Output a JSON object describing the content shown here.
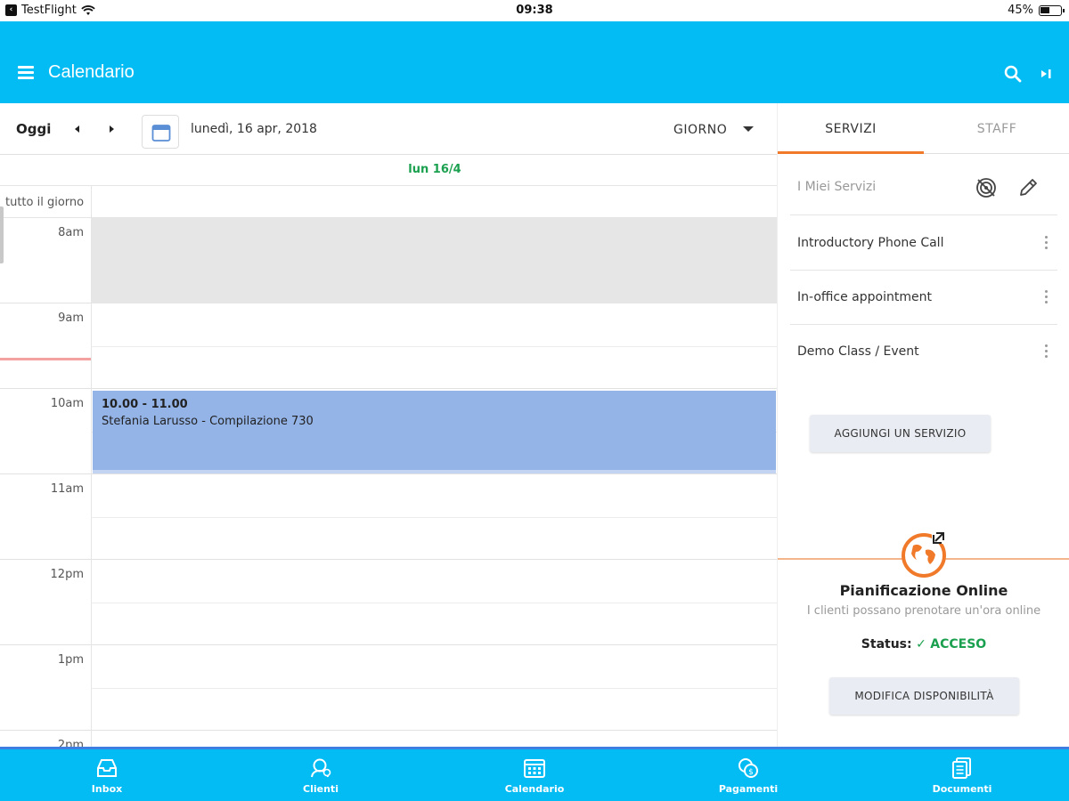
{
  "status_bar": {
    "app": "TestFlight",
    "time": "09:38",
    "battery": "45%"
  },
  "header": {
    "title": "Calendario"
  },
  "toolbar": {
    "today": "Oggi",
    "date": "lunedì, 16 apr, 2018",
    "view": "GIORNO"
  },
  "calendar": {
    "day_header": "lun 16/4",
    "all_day": "tutto il giorno",
    "hours": [
      "8am",
      "9am",
      "10am",
      "11am",
      "12pm",
      "1pm",
      "2pm"
    ],
    "event": {
      "time": "10.00 - 11.00",
      "title": "Stefania Larusso - Compilazione 730"
    }
  },
  "panel": {
    "tabs": [
      "SERVIZI",
      "STAFF"
    ],
    "services_title": "I Miei Servizi",
    "services": [
      "Introductory Phone Call",
      "In-office appointment",
      "Demo Class / Event"
    ],
    "add_service": "AGGIUNGI UN SERVIZIO",
    "online": {
      "title": "Pianificazione Online",
      "subtitle": "I clienti possano prenotare un'ora online",
      "status_label": "Status:",
      "status_value": "ACCESO",
      "edit_button": "MODIFICA DISPONIBILITÀ"
    }
  },
  "bottom_nav": [
    "Inbox",
    "Clienti",
    "Calendario",
    "Pagamenti",
    "Documenti"
  ],
  "colors": {
    "primary": "#04bcf4",
    "accent": "#f07a2a",
    "event": "#94b4e8",
    "success": "#1aa04e"
  }
}
